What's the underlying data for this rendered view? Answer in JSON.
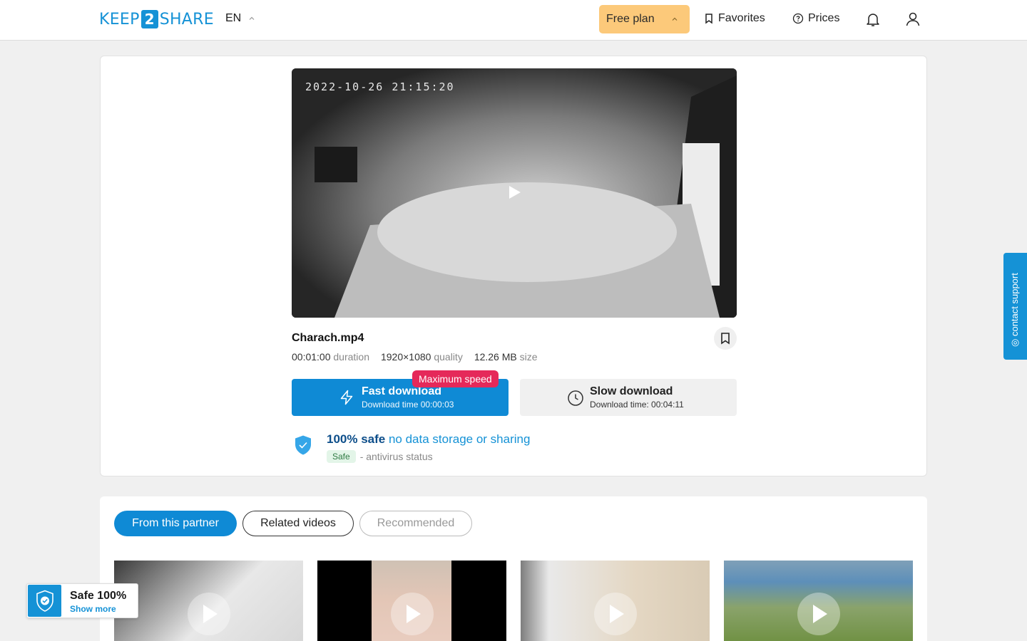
{
  "header": {
    "logo": {
      "left": "KEEP",
      "mid": "2",
      "right": "SHARE"
    },
    "language": "EN",
    "plan_label": "Free plan",
    "favorites_label": "Favorites",
    "prices_label": "Prices"
  },
  "video": {
    "timestamp_overlay": "2022-10-26 21:15:20",
    "filename": "Charach.mp4",
    "duration_value": "00:01:00",
    "duration_label": "duration",
    "quality_value": "1920×1080",
    "quality_label": "quality",
    "size_value": "12.26 MB",
    "size_label": "size"
  },
  "download": {
    "fast_title": "Fast download",
    "fast_sub": "Download time 00:00:03",
    "badge": "Maximum speed",
    "slow_title": "Slow download",
    "slow_sub": "Download time: 00:04:11"
  },
  "safety": {
    "bold": "100% safe",
    "rest": "no data storage or sharing",
    "av_badge": "Safe",
    "av_text": "- antivirus status"
  },
  "tabs": [
    {
      "label": "From this partner",
      "active": true
    },
    {
      "label": "Related videos",
      "active": false
    },
    {
      "label": "Recommended",
      "active": false
    }
  ],
  "support_label": "contact support",
  "safe_widget": {
    "title": "Safe 100%",
    "link": "Show more"
  },
  "colors": {
    "accent": "#0f8ad5",
    "plan": "#fcc97a",
    "badge": "#e5295a"
  }
}
